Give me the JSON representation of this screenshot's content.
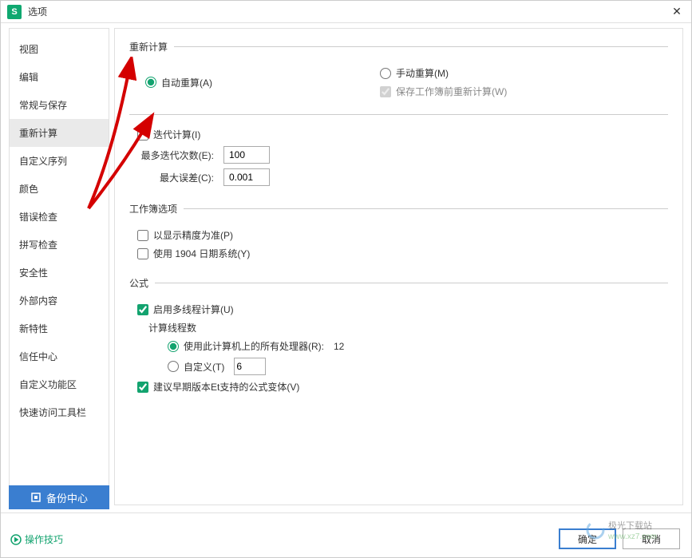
{
  "title": "选项",
  "app_icon_letter": "S",
  "sidebar": {
    "items": [
      {
        "label": "视图"
      },
      {
        "label": "编辑"
      },
      {
        "label": "常规与保存"
      },
      {
        "label": "重新计算"
      },
      {
        "label": "自定义序列"
      },
      {
        "label": "颜色"
      },
      {
        "label": "错误检查"
      },
      {
        "label": "拼写检查"
      },
      {
        "label": "安全性"
      },
      {
        "label": "外部内容"
      },
      {
        "label": "新特性"
      },
      {
        "label": "信任中心"
      },
      {
        "label": "自定义功能区"
      },
      {
        "label": "快速访问工具栏"
      }
    ]
  },
  "sections": {
    "recalc": {
      "legend": "重新计算",
      "auto": "自动重算(A)",
      "manual": "手动重算(M)",
      "save_before": "保存工作簿前重新计算(W)"
    },
    "iter": {
      "enable": "迭代计算(I)",
      "max_iter_label": "最多迭代次数(E):",
      "max_iter_value": "100",
      "max_diff_label": "最大误差(C):",
      "max_diff_value": "0.001"
    },
    "workbook": {
      "legend": "工作簿选项",
      "precision": "以显示精度为准(P)",
      "date1904": "使用 1904 日期系统(Y)"
    },
    "formula": {
      "legend": "公式",
      "multithread": "启用多线程计算(U)",
      "threads_label": "计算线程数",
      "use_all": "使用此计算机上的所有处理器(R):",
      "processor_count": "12",
      "custom": "自定义(T)",
      "custom_value": "6",
      "legacy": "建议早期版本Et支持的公式变体(V)"
    }
  },
  "footer": {
    "backup": "备份中心",
    "tips": "操作技巧",
    "ok": "确定",
    "cancel": "取消"
  },
  "watermark": {
    "line1": "极光下载站",
    "line2": "www.xz7.com"
  }
}
